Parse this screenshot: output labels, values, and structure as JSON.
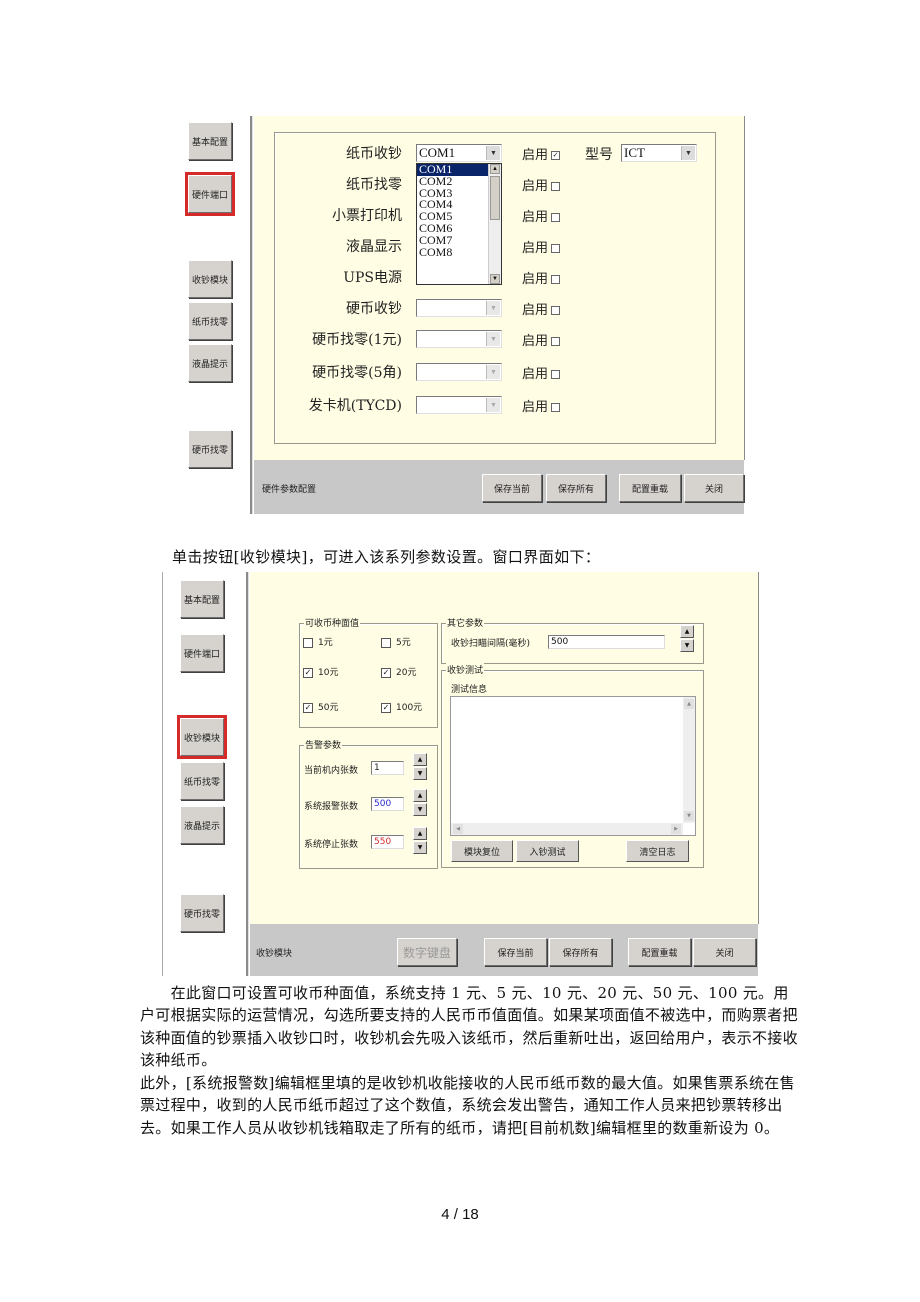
{
  "screen1": {
    "sidebar": [
      "基本配置",
      "硬件端口",
      "收钞模块",
      "纸币找零",
      "液晶提示",
      "硬币找零"
    ],
    "active_sidebar": "硬件端口",
    "rows": [
      {
        "label": "纸币收钞",
        "port": "COM1",
        "enable_label": "启用",
        "enabled": true,
        "disabled_combo": false
      },
      {
        "label": "纸币找零",
        "port": "",
        "enable_label": "启用",
        "enabled": false,
        "disabled_combo": false
      },
      {
        "label": "小票打印机",
        "port": "",
        "enable_label": "启用",
        "enabled": false,
        "disabled_combo": false
      },
      {
        "label": "液晶显示",
        "port": "",
        "enable_label": "启用",
        "enabled": false,
        "disabled_combo": false
      },
      {
        "label": "UPS电源",
        "port": "",
        "enable_label": "启用",
        "enabled": false,
        "disabled_combo": false
      },
      {
        "label": "硬币收钞",
        "port": "",
        "enable_label": "启用",
        "enabled": false,
        "disabled_combo": true
      },
      {
        "label": "硬币找零(1元)",
        "port": "",
        "enable_label": "启用",
        "enabled": false,
        "disabled_combo": true
      },
      {
        "label": "硬币找零(5角)",
        "port": "",
        "enable_label": "启用",
        "enabled": false,
        "disabled_combo": true
      },
      {
        "label": "发卡机(TYCD)",
        "port": "",
        "enable_label": "启用",
        "enabled": false,
        "disabled_combo": true
      }
    ],
    "model_label": "型号",
    "model_value": "ICT",
    "dropdown_options": [
      "COM1",
      "COM2",
      "COM3",
      "COM4",
      "COM5",
      "COM6",
      "COM7",
      "COM8"
    ],
    "dropdown_selected": "COM1",
    "status_text": "硬件参数配置",
    "buttons": {
      "save_current": "保存当前",
      "save_all": "保存所有",
      "reload": "配置重载",
      "close": "关闭"
    }
  },
  "caption1": "单击按钮[收钞模块]，可进入该系列参数设置。窗口界面如下：",
  "screen2": {
    "sidebar": [
      "基本配置",
      "硬件端口",
      "收钞模块",
      "纸币找零",
      "液晶提示",
      "硬币找零"
    ],
    "active_sidebar": "收钞模块",
    "denominations_title": "可收币种面值",
    "denominations": [
      {
        "label": "1元",
        "checked": false
      },
      {
        "label": "5元",
        "checked": false
      },
      {
        "label": "10元",
        "checked": true
      },
      {
        "label": "20元",
        "checked": true
      },
      {
        "label": "50元",
        "checked": true
      },
      {
        "label": "100元",
        "checked": true
      }
    ],
    "alarm_title": "告警参数",
    "alarm_params": [
      {
        "label": "当前机内张数",
        "value": "1",
        "color": "#222222"
      },
      {
        "label": "系统报警张数",
        "value": "500",
        "color": "#2a2ad0"
      },
      {
        "label": "系统停止张数",
        "value": "550",
        "color": "#d02a2a"
      }
    ],
    "other_title": "其它参数",
    "scan_interval_label": "收钞扫瞄间隔(毫秒)",
    "scan_interval_value": "500",
    "test_title": "收钞测试",
    "test_info_label": "测试信息",
    "test_log": "",
    "test_buttons": {
      "reset": "模块复位",
      "insert_test": "入钞测试",
      "clear_log": "清空日志"
    },
    "status_text": "收钞模块",
    "buttons": {
      "numpad": "数字键盘",
      "save_current": "保存当前",
      "save_all": "保存所有",
      "reload": "配置重载",
      "close": "关闭"
    }
  },
  "paragraphs": [
    "　　在此窗口可设置可收币种面值，系统支持 1 元、5 元、10 元、20 元、50 元、100 元。用户可根据实际的运营情况，勾选所要支持的人民币币值面值。如果某项面值不被选中，而购票者把该种面值的钞票插入收钞口时，收钞机会先吸入该纸币，然后重新吐出，返回给用户，表示不接收该种纸币。",
    "此外，[系统报警数]编辑框里填的是收钞机收能接收的人民币纸币数的最大值。如果售票系统在售票过程中，收到的人民币纸币超过了这个数值，系统会发出警告，通知工作人员来把钞票转移出去。如果工作人员从收钞机钱箱取走了所有的纸币，请把[目前机数]编辑框里的数重新设为 0。"
  ],
  "page_number": "4 / 18"
}
